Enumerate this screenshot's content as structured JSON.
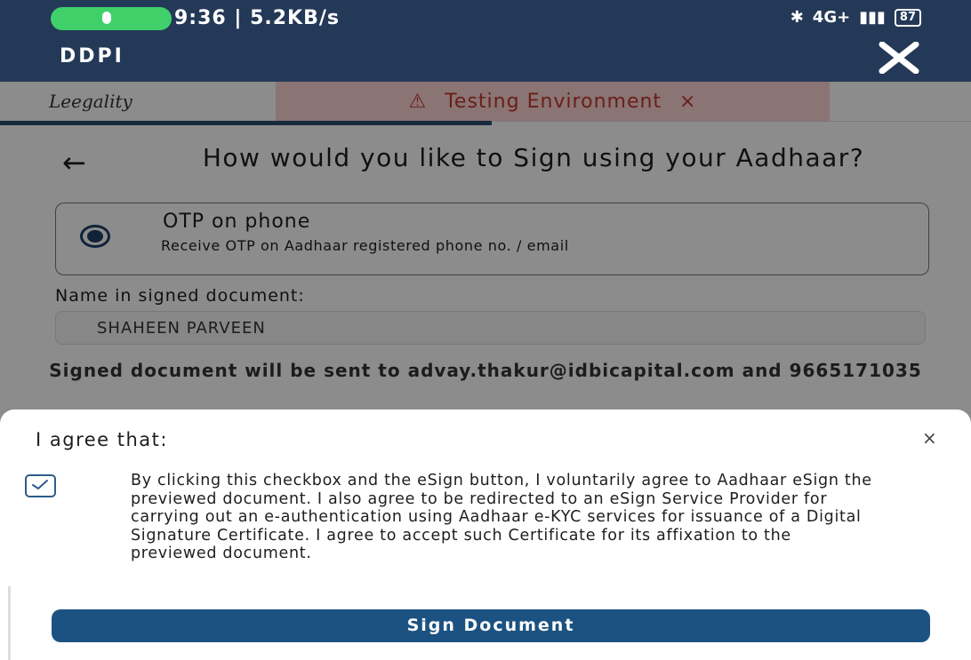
{
  "status_bar": {
    "time_and_speed": "9:36 | 5.2KB/s",
    "network": "4G+",
    "battery": "87"
  },
  "app_bar": {
    "title": "DDPI",
    "close_icon": "close-icon"
  },
  "brand": {
    "logo_text": "Leegality"
  },
  "banner": {
    "text": "Testing Environment",
    "dismiss": "×",
    "color": "#c0392b"
  },
  "main": {
    "heading": "How would you like to Sign using your Aadhaar?",
    "option": {
      "title": "OTP on phone",
      "subtitle": "Receive OTP on Aadhaar registered phone no. / email"
    },
    "name_label": "Name in signed document:",
    "name_value": "SHAHEEN PARVEEN",
    "sent_info": "Signed document will be sent to advay.thakur@idbicapital.com and 9665171035"
  },
  "sheet": {
    "title": "I agree that:",
    "close": "×",
    "agreement": "By clicking this checkbox and the eSign button, I voluntarily agree to Aadhaar eSign the previewed document. I also agree to be redirected to an eSign Service Provider for carrying out an e-authentication using Aadhaar e-KYC services for issuance of a Digital Signature Certificate. I agree to accept such Certificate for its affixation to the previewed document.",
    "button": "Sign Document"
  },
  "colors": {
    "header": "#243957",
    "primary_button": "#1c5281",
    "call_pill": "#3fd06a"
  }
}
